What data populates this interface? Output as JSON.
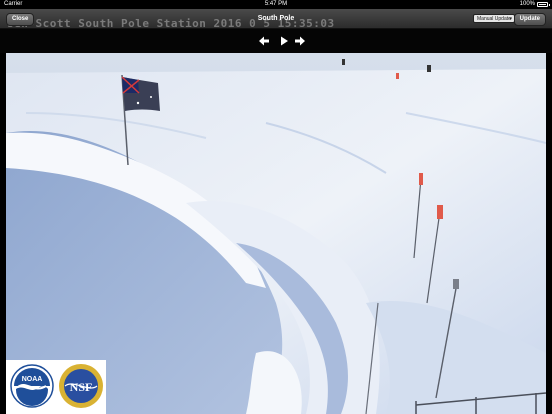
{
  "status_bar": {
    "carrier": "Carrier",
    "time": "5:47 PM",
    "battery": "100%"
  },
  "nav": {
    "close_label": "Close",
    "title": "South Pole",
    "mode_select_value": "Manual Update",
    "update_label": "Update"
  },
  "camera": {
    "overlay_text": "sen-Scott South Pole Station 2016 0 5 15:35:03"
  },
  "toolbar": {
    "icons": [
      "arrow-left-icon",
      "play-icon",
      "arrow-right-icon"
    ]
  },
  "logos": {
    "noaa_text": "NOAA",
    "nsf_text": "NSF"
  },
  "colors": {
    "nav_bar": "#3a3a3a",
    "sky": "#c6d3e6",
    "snow": "#e4e9f3",
    "snow_shadow": "#9fb3d5",
    "marker": "#e05a4a",
    "noaa_blue": "#1f4f9a",
    "nsf_gold": "#d9b233"
  }
}
